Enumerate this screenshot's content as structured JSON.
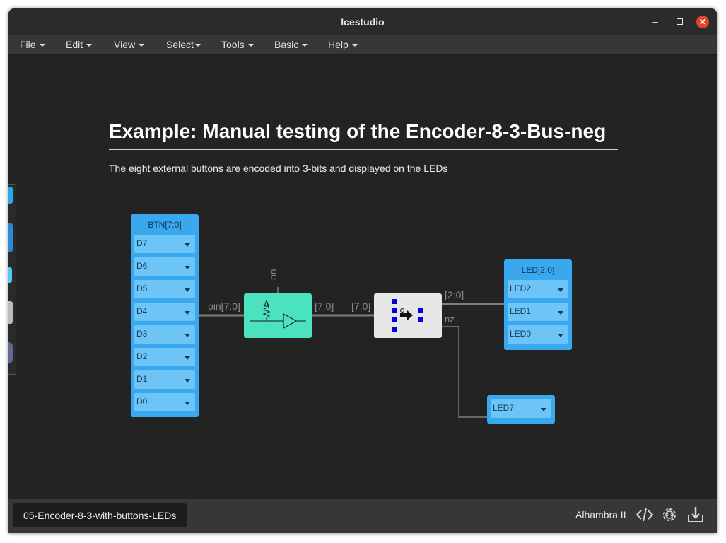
{
  "window": {
    "title": "Icestudio"
  },
  "menu": [
    {
      "label": "File"
    },
    {
      "label": "Edit"
    },
    {
      "label": "View"
    },
    {
      "label": "Select"
    },
    {
      "label": "Tools"
    },
    {
      "label": "Basic"
    },
    {
      "label": "Help"
    }
  ],
  "canvas": {
    "heading": "Example: Manual testing of the Encoder-8-3-Bus-neg",
    "description": "The eight external buttons are encoded into 3-bits and displayed on the LEDs"
  },
  "input_block": {
    "title": "BTN[7:0]",
    "pins": [
      "D7",
      "D6",
      "D5",
      "D4",
      "D3",
      "D2",
      "D1",
      "D0"
    ]
  },
  "led_block": {
    "title": "LED[2:0]",
    "pins": [
      "LED2",
      "LED1",
      "LED0"
    ]
  },
  "led7_block": {
    "pin": "LED7"
  },
  "wire_labels": {
    "pin_bus": "pin[7:0]",
    "on": "on",
    "bus_out_1": "[7:0]",
    "bus_in_2": "[7:0]",
    "bus_out_2": "[2:0]",
    "nz": "nz"
  },
  "bottombar": {
    "project_name": "05-Encoder-8-3-with-buttons-LEDs",
    "board": "Alhambra II"
  },
  "icons": [
    "code-icon",
    "settings-gear-icon",
    "download-icon"
  ],
  "colors": {
    "io_block": "#3aa8ef",
    "pullup_block": "#4be2c0",
    "encoder_block": "#e7e7e7",
    "close_button": "#e2452a"
  }
}
